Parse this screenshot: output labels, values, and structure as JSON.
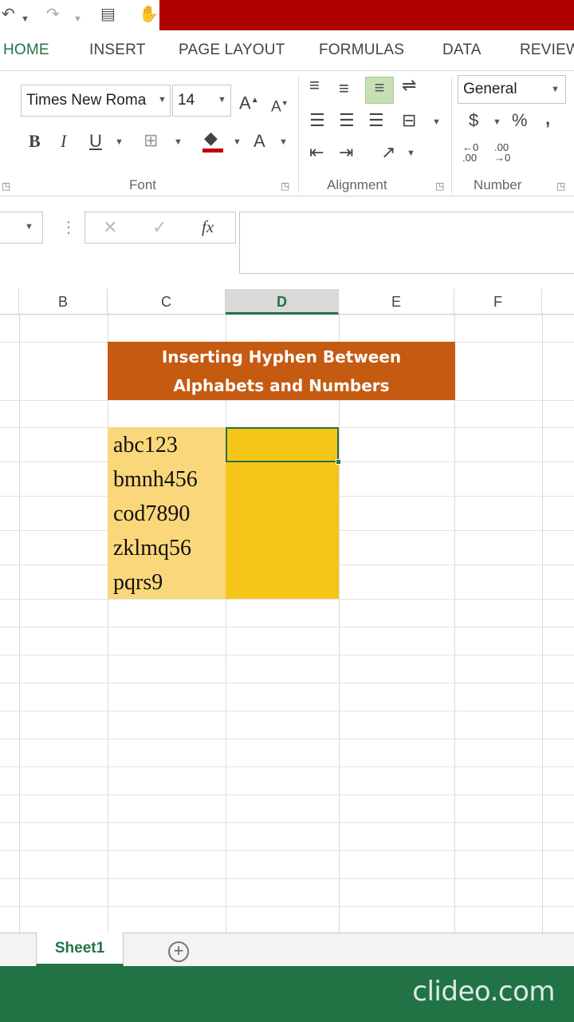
{
  "ribbon_tabs": [
    "HOME",
    "INSERT",
    "PAGE LAYOUT",
    "FORMULAS",
    "DATA",
    "REVIEW"
  ],
  "font": {
    "name": "Times New Roma",
    "size": "14",
    "group_label": "Font",
    "grow_icon": "A",
    "shrink_icon": "A",
    "bold": "B",
    "italic": "I",
    "underline": "U",
    "font_color": "A"
  },
  "alignment": {
    "group_label": "Alignment"
  },
  "number": {
    "format": "General",
    "group_label": "Number",
    "currency": "$",
    "percent": "%",
    "comma": ","
  },
  "formula_bar": {
    "fx": "fx",
    "cancel": "✕",
    "enter": "✓",
    "value": ""
  },
  "columns": [
    "B",
    "C",
    "D",
    "E",
    "F"
  ],
  "selected_column": "D",
  "sheet": {
    "title_line1": "Inserting Hyphen Between",
    "title_line2": "Alphabets and Numbers",
    "values": [
      "abc123",
      "bmnh456",
      "cod7890",
      "zklmq56",
      "pqrs9"
    ]
  },
  "sheet_tab": "Sheet1",
  "add_sheet": "+",
  "watermark": "clideo.com",
  "colors": {
    "excel_green": "#217346",
    "title_fill": "#c55a11",
    "input_fill": "#fad77a",
    "output_fill": "#f5c518",
    "top_bar_red": "#b00000"
  }
}
